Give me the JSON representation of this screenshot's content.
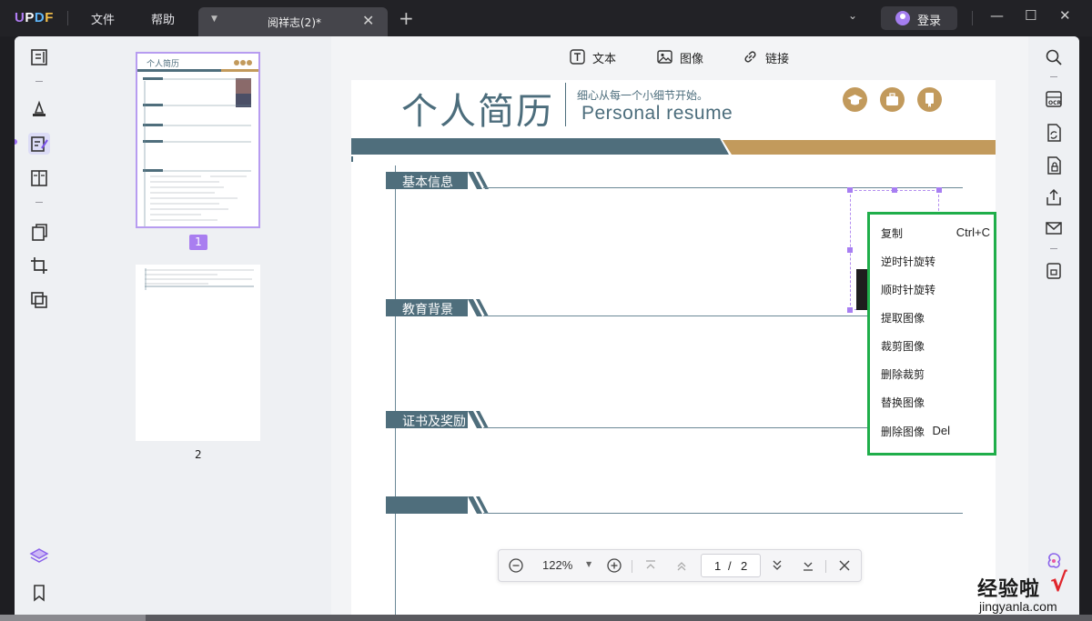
{
  "app": {
    "logo": "UPDF",
    "logo_parts": [
      "U",
      "P",
      "D",
      "F"
    ]
  },
  "menu": {
    "file": "文件",
    "help": "帮助"
  },
  "tab": {
    "title": "阅祥志(2)*",
    "close": "✕",
    "add": "+"
  },
  "account": {
    "login_label": "登录"
  },
  "window": {
    "minimize": "—",
    "maximize": "☐",
    "close": "✕"
  },
  "left_toolbar": {
    "items": [
      "reader-icon",
      "comment-icon",
      "edit-icon",
      "pages-icon",
      "convert-icon",
      "crop-icon",
      "protect-icon",
      "layers-icon",
      "bookmark-icon"
    ],
    "active": "edit-icon"
  },
  "thumbnails": [
    {
      "page": "1",
      "selected": true
    },
    {
      "page": "2",
      "selected": false
    }
  ],
  "doc_tools": {
    "text": "文本",
    "image": "图像",
    "link": "链接"
  },
  "resume": {
    "title": "个人简历",
    "subtitle_cn": "细心从每一个小细节开始。",
    "subtitle_en": "Personal  resume",
    "sections": [
      "基本信息",
      "教育背景",
      "证书及奖励",
      ""
    ],
    "colors": {
      "slate": "#4f6e7c",
      "gold": "#c29a5c"
    }
  },
  "context_menu": {
    "items": [
      {
        "label": "复制",
        "shortcut": "Ctrl+C"
      },
      {
        "label": "逆时针旋转",
        "shortcut": ""
      },
      {
        "label": "顺时针旋转",
        "shortcut": ""
      },
      {
        "label": "提取图像",
        "shortcut": ""
      },
      {
        "label": "裁剪图像",
        "shortcut": ""
      },
      {
        "label": "删除裁剪",
        "shortcut": ""
      },
      {
        "label": "替换图像",
        "shortcut": ""
      },
      {
        "label": "删除图像",
        "shortcut": "Del"
      }
    ],
    "highlight_color": "#1fae4a"
  },
  "navigation": {
    "zoom": "122%",
    "current_page": "1",
    "separator": "/",
    "total_pages": "2"
  },
  "watermark": {
    "text_cn": "经验啦",
    "check": "√",
    "text_en": "jingyanla.com"
  }
}
